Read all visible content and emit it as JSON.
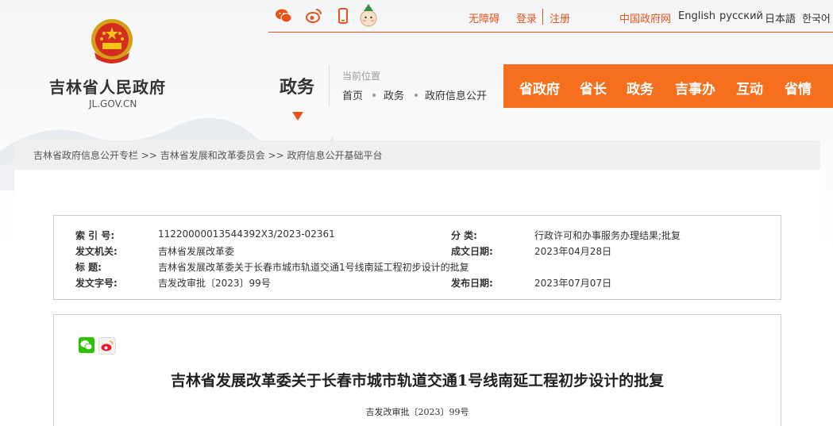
{
  "header": {
    "site_title": "吉林省人民政府",
    "site_domain": "JL.GOV.CN",
    "links": {
      "accessibility": "无障碍",
      "login": "登录",
      "register": "注册",
      "china_gov": "中国政府网",
      "english": "English",
      "russian": "русский",
      "japanese": "日本語",
      "korean": "한국어"
    },
    "accent_color": "#e7531b"
  },
  "section": {
    "title": "政务",
    "location_label": "当前位置",
    "crumbs": [
      "首页",
      "政务",
      "政府信息公开"
    ]
  },
  "nav": [
    "省政府",
    "省长",
    "政务",
    "吉事办",
    "互动",
    "省情"
  ],
  "breadcrumb_strip": "吉林省政府信息公开专栏 >> 吉林省发展和改革委员会 >> 政府信息公开基础平台",
  "info": {
    "index_label": "索 引 号:",
    "index_value": "11220000013544392X3/2023-02361",
    "category_label": "分    类:",
    "category_value": "行政许可和办事服务办理结果;批复",
    "issuer_label": "发文机关:",
    "issuer_value": "吉林省发展改革委",
    "date_written_label": "成文日期:",
    "date_written_value": "2023年04月28日",
    "title_label": "标      题:",
    "title_value": "吉林省发展改革委关于长春市城市轨道交通1号线南延工程初步设计的批复",
    "doc_no_label": "发文字号:",
    "doc_no_value": "吉发改审批〔2023〕99号",
    "publish_date_label": "发布日期:",
    "publish_date_value": "2023年07月07日"
  },
  "article": {
    "title": "吉林省发展改革委关于长春市城市轨道交通1号线南延工程初步设计的批复",
    "doc_number": "吉发改审批〔2023〕99号",
    "share_icons": [
      "wechat-icon",
      "weibo-icon"
    ]
  }
}
